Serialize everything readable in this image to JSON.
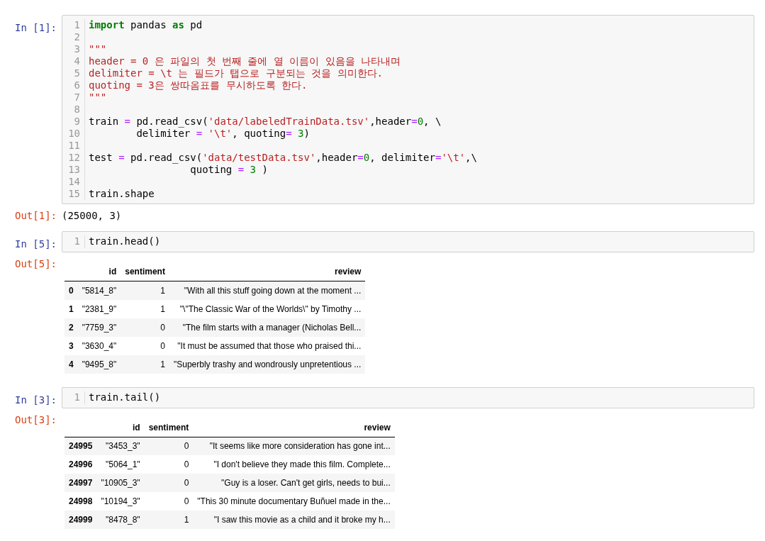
{
  "cells": [
    {
      "prompt": "In [1]:",
      "lines": [
        {
          "number": "1",
          "tokens": [
            {
              "text": "import",
              "kind": "keyword"
            },
            {
              "text": " pandas ",
              "kind": "plain"
            },
            {
              "text": "as",
              "kind": "keyword"
            },
            {
              "text": " pd",
              "kind": "plain"
            }
          ]
        },
        {
          "number": "2"
        },
        {
          "number": "3",
          "tokens": [
            {
              "text": "\"\"\"",
              "kind": "string"
            }
          ]
        },
        {
          "number": "4",
          "tokens": [
            {
              "text": "header = 0 은 파일의 첫 번째 줄에 열 이름이 있음을 나타내며",
              "kind": "string"
            }
          ]
        },
        {
          "number": "5",
          "tokens": [
            {
              "text": "delimiter = \\t 는 필드가 탭으로 구분되는 것을 의미한다.",
              "kind": "string"
            }
          ]
        },
        {
          "number": "6",
          "tokens": [
            {
              "text": "quoting = 3은 쌍따옴표를 무시하도록 한다.",
              "kind": "string"
            }
          ]
        },
        {
          "number": "7",
          "tokens": [
            {
              "text": "\"\"\"",
              "kind": "string"
            }
          ]
        },
        {
          "number": "8"
        },
        {
          "number": "9",
          "tokens": [
            {
              "text": "train ",
              "kind": "plain"
            },
            {
              "text": "=",
              "kind": "operator"
            },
            {
              "text": " pd.read_csv(",
              "kind": "plain"
            },
            {
              "text": "'data/labeledTrainData.tsv'",
              "kind": "string"
            },
            {
              "text": ",header",
              "kind": "plain"
            },
            {
              "text": "=",
              "kind": "operator"
            },
            {
              "text": "0",
              "kind": "number"
            },
            {
              "text": ", \\",
              "kind": "plain"
            }
          ]
        },
        {
          "number": "10",
          "tokens": [
            {
              "text": "        delimiter ",
              "kind": "plain"
            },
            {
              "text": "=",
              "kind": "operator"
            },
            {
              "text": " '\\t'",
              "kind": "string"
            },
            {
              "text": ", quoting",
              "kind": "plain"
            },
            {
              "text": "=",
              "kind": "operator"
            },
            {
              "text": " 3",
              "kind": "number"
            },
            {
              "text": ")",
              "kind": "plain"
            }
          ]
        },
        {
          "number": "11"
        },
        {
          "number": "12",
          "tokens": [
            {
              "text": "test ",
              "kind": "plain"
            },
            {
              "text": "=",
              "kind": "operator"
            },
            {
              "text": " pd.read_csv(",
              "kind": "plain"
            },
            {
              "text": "'data/testData.tsv'",
              "kind": "string"
            },
            {
              "text": ",header",
              "kind": "plain"
            },
            {
              "text": "=",
              "kind": "operator"
            },
            {
              "text": "0",
              "kind": "number"
            },
            {
              "text": ", delimiter",
              "kind": "plain"
            },
            {
              "text": "=",
              "kind": "operator"
            },
            {
              "text": "'\\t'",
              "kind": "string"
            },
            {
              "text": ",\\",
              "kind": "plain"
            }
          ]
        },
        {
          "number": "13",
          "tokens": [
            {
              "text": "                 quoting ",
              "kind": "plain"
            },
            {
              "text": "=",
              "kind": "operator"
            },
            {
              "text": " 3",
              "kind": "number"
            },
            {
              "text": " )",
              "kind": "plain"
            }
          ]
        },
        {
          "number": "14"
        },
        {
          "number": "15",
          "tokens": [
            {
              "text": "train.shape",
              "kind": "plain"
            }
          ]
        }
      ],
      "output": {
        "prompt": "Out[1]:",
        "kind": "text",
        "text": "(25000, 3)"
      }
    },
    {
      "prompt": "In [5]:",
      "lines": [
        {
          "number": "1",
          "tokens": [
            {
              "text": "train.head()",
              "kind": "plain"
            }
          ]
        }
      ],
      "output": {
        "prompt": "Out[5]:",
        "kind": "table",
        "columns": [
          "id",
          "sentiment",
          "review"
        ],
        "rows": [
          {
            "index": "0",
            "cells": [
              "\"5814_8\"",
              "1",
              "\"With all this stuff going down at the moment ..."
            ]
          },
          {
            "index": "1",
            "cells": [
              "\"2381_9\"",
              "1",
              "\"\\\"The Classic War of the Worlds\\\" by Timothy ..."
            ]
          },
          {
            "index": "2",
            "cells": [
              "\"7759_3\"",
              "0",
              "\"The film starts with a manager (Nicholas Bell..."
            ]
          },
          {
            "index": "3",
            "cells": [
              "\"3630_4\"",
              "0",
              "\"It must be assumed that those who praised thi..."
            ]
          },
          {
            "index": "4",
            "cells": [
              "\"9495_8\"",
              "1",
              "\"Superbly trashy and wondrously unpretentious ..."
            ]
          }
        ]
      }
    },
    {
      "prompt": "In [3]:",
      "lines": [
        {
          "number": "1",
          "tokens": [
            {
              "text": "train.tail()",
              "kind": "plain"
            }
          ]
        }
      ],
      "output": {
        "prompt": "Out[3]:",
        "kind": "table",
        "columns": [
          "id",
          "sentiment",
          "review"
        ],
        "rows": [
          {
            "index": "24995",
            "cells": [
              "\"3453_3\"",
              "0",
              "\"It seems like more consideration has gone int..."
            ]
          },
          {
            "index": "24996",
            "cells": [
              "\"5064_1\"",
              "0",
              "\"I don't believe they made this film. Complete..."
            ]
          },
          {
            "index": "24997",
            "cells": [
              "\"10905_3\"",
              "0",
              "\"Guy is a loser. Can't get girls, needs to bui..."
            ]
          },
          {
            "index": "24998",
            "cells": [
              "\"10194_3\"",
              "0",
              "\"This 30 minute documentary Buñuel made in the..."
            ]
          },
          {
            "index": "24999",
            "cells": [
              "\"8478_8\"",
              "1",
              "\"I saw this movie as a child and it broke my h..."
            ]
          }
        ]
      }
    }
  ]
}
